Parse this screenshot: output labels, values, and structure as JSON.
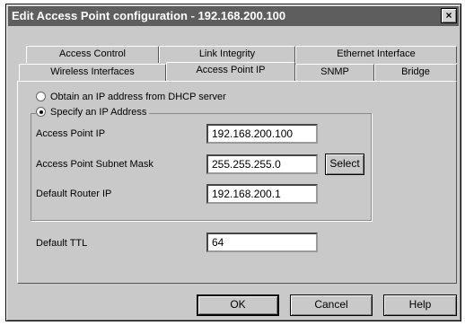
{
  "window": {
    "title": "Edit Access Point configuration - 192.168.200.100",
    "close_glyph": "×"
  },
  "tabs": {
    "row1": [
      {
        "label": "Access Control"
      },
      {
        "label": "Link Integrity"
      },
      {
        "label": "Ethernet Interface"
      }
    ],
    "row2": [
      {
        "label": "Wireless Interfaces"
      },
      {
        "label": "Access Point IP",
        "selected": true
      },
      {
        "label": "SNMP"
      },
      {
        "label": "Bridge"
      }
    ]
  },
  "ip_mode": {
    "dhcp_label": "Obtain an IP address from DHCP server",
    "static_label": "Specify an IP Address",
    "selected": "static"
  },
  "fields": {
    "ap_ip": {
      "label": "Access Point IP",
      "value": "192.168.200.100"
    },
    "subnet": {
      "label": "Access Point Subnet Mask",
      "value": "255.255.255.0"
    },
    "router": {
      "label": "Default Router IP",
      "value": "192.168.200.1"
    },
    "ttl": {
      "label": "Default TTL",
      "value": "64"
    }
  },
  "buttons": {
    "select": "Select",
    "ok": "OK",
    "cancel": "Cancel",
    "help": "Help"
  }
}
